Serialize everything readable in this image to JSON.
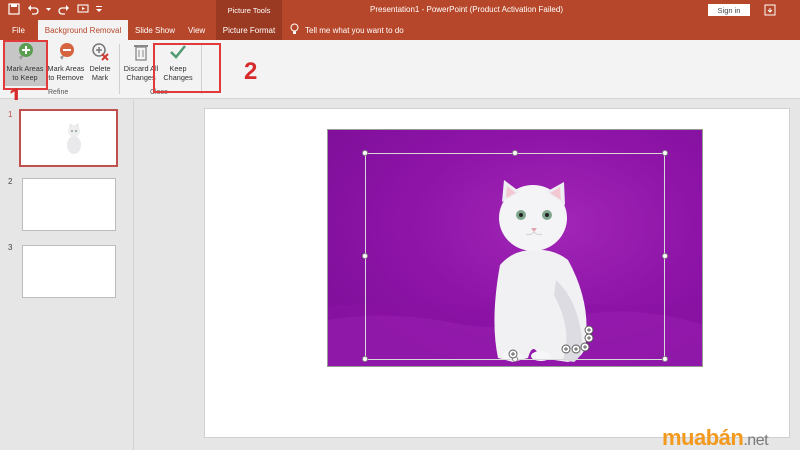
{
  "titlebar": {
    "tools_tab": "Picture Tools",
    "doc_title": "Presentation1 - PowerPoint (Product Activation Failed)",
    "signin": "Sign in"
  },
  "tabs": {
    "file": "File",
    "background_removal": "Background Removal",
    "slide_show": "Slide Show",
    "view": "View",
    "picture_format": "Picture Format",
    "tell_me": "Tell me what you want to do"
  },
  "ribbon": {
    "mark_keep": [
      "Mark Areas",
      "to Keep"
    ],
    "mark_remove": [
      "Mark Areas",
      "to Remove"
    ],
    "delete_mark": [
      "Delete",
      "Mark"
    ],
    "discard_all": [
      "Discard All",
      "Changes"
    ],
    "keep_changes": [
      "Keep",
      "Changes"
    ],
    "group_refine": "Refine",
    "group_close": "Close"
  },
  "annotations": {
    "step1": "1",
    "step2": "2"
  },
  "slides": [
    {
      "number": "1",
      "active": true
    },
    {
      "number": "2",
      "active": false
    },
    {
      "number": "3",
      "active": false
    }
  ],
  "brand": {
    "name": "muabán",
    "tld": ".net"
  },
  "colors": {
    "accent": "#b7472a",
    "removal_overlay": "#8e14a8",
    "annotation_red": "#d72b2b",
    "brand_orange": "#f39a1e"
  }
}
